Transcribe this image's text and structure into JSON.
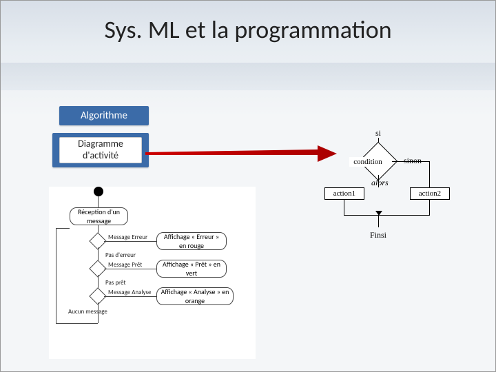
{
  "title": "Sys. ML et la programmation",
  "tabs": {
    "algorithme": "Algorithme",
    "diagramme": "Diagramme d'activité"
  },
  "flowchart": {
    "si": "si",
    "condition": "condition",
    "sinon": "sinon",
    "alors": "alors",
    "action1": "action1",
    "action2": "action2",
    "finsi": "Finsi"
  },
  "activity": {
    "reception": "Réception d'un message",
    "msg_erreur": "Message Erreur",
    "pas_erreur": "Pas d'erreur",
    "msg_pret": "Message Prêt",
    "pas_pret": "Pas prêt",
    "msg_analyse": "Message Analyse",
    "aucun": "Aucun message",
    "aff_erreur": "Affichage « Erreur » en rouge",
    "aff_pret": "Affichage « Prêt » en vert",
    "aff_analyse": "Affichage « Analyse » en orange"
  }
}
